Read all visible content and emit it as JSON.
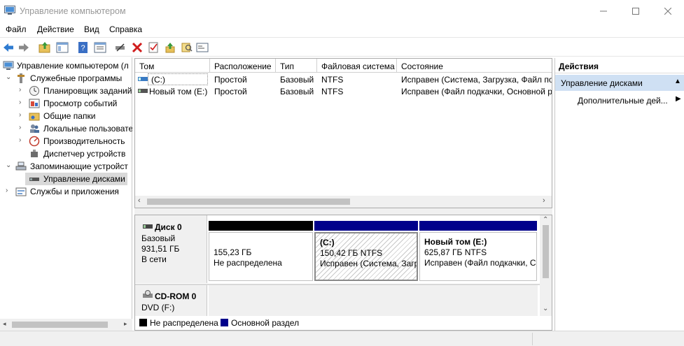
{
  "window": {
    "title": "Управление компьютером"
  },
  "menu": [
    "Файл",
    "Действие",
    "Вид",
    "Справка"
  ],
  "tree": {
    "root": "Управление компьютером (л",
    "system_tools": "Служебные программы",
    "task_scheduler": "Планировщик заданий",
    "event_viewer": "Просмотр событий",
    "shared_folders": "Общие папки",
    "local_users": "Локальные пользовате",
    "performance": "Производительность",
    "device_manager": "Диспетчер устройств",
    "storage": "Запоминающие устройст",
    "disk_management": "Управление дисками",
    "services": "Службы и приложения"
  },
  "volumes": {
    "columns": [
      "Том",
      "Расположение",
      "Тип",
      "Файловая система",
      "Состояние"
    ],
    "rows": [
      {
        "volume": "(C:)",
        "layout": "Простой",
        "type": "Базовый",
        "fs": "NTFS",
        "status": "Исправен (Система, Загрузка, Файл по"
      },
      {
        "volume": "Новый том (E:)",
        "layout": "Простой",
        "type": "Базовый",
        "fs": "NTFS",
        "status": "Исправен (Файл подкачки, Основной р"
      }
    ]
  },
  "disks": {
    "disk0": {
      "name": "Диск 0",
      "type": "Базовый",
      "size": "931,51 ГБ",
      "state": "В сети"
    },
    "partitions": [
      {
        "title": "",
        "size": "155,23 ГБ",
        "status": "Не распределена",
        "color": "#000000"
      },
      {
        "title": "(C:)",
        "size": "150,42 ГБ NTFS",
        "status": "Исправен (Система, Загр",
        "color": "#00008b"
      },
      {
        "title": "Новый том  (E:)",
        "size": "625,87 ГБ NTFS",
        "status": "Исправен (Файл подкачки, С",
        "color": "#00008b"
      }
    ],
    "cdrom": {
      "name": "CD-ROM 0",
      "drive": "DVD (F:)"
    }
  },
  "legend": {
    "unallocated": "Не распределена",
    "primary": "Основной раздел",
    "unallocated_color": "#000000",
    "primary_color": "#00008b"
  },
  "actions": {
    "header": "Действия",
    "section": "Управление дисками",
    "more": "Дополнительные дей..."
  }
}
